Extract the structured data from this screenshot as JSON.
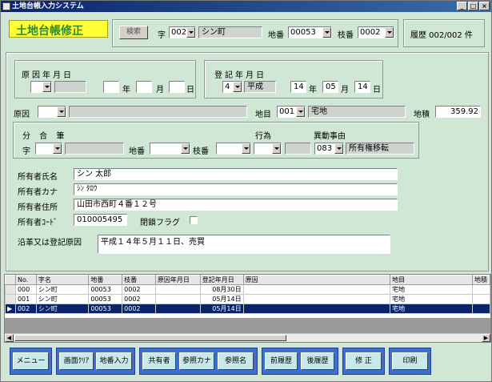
{
  "window": {
    "title": "土地台帳入力システム",
    "min": "_",
    "max": "□",
    "close": "×"
  },
  "header": {
    "form_title": "土地台帳修正",
    "search_button": "検索",
    "aza_label": "字",
    "aza_code": "002",
    "aza_name": "シン町",
    "chiban_label": "地番",
    "chiban_value": "00053",
    "edaban_label": "枝番",
    "edaban_value": "0002",
    "history": "履歴 002/002 件"
  },
  "cause_date": {
    "title": "原因年月日",
    "era": "",
    "era_name": "",
    "year_label": "年",
    "month_label": "月",
    "day_label": "日",
    "year": "",
    "month": "",
    "day": ""
  },
  "reg_date": {
    "title": "登記年月日",
    "era": "4",
    "era_name": "平成",
    "year": "14",
    "year_label": "年",
    "month": "05",
    "month_label": "月",
    "day": "14",
    "day_label": "日"
  },
  "row2": {
    "cause_label": "原因",
    "cause_code": "",
    "cause_name": "",
    "chimoku_label": "地目",
    "chimoku_code": "001",
    "chimoku_name": "宅地",
    "area_label": "地積",
    "area_value": "359.92"
  },
  "bunpitsu": {
    "title": "分 合 筆",
    "aza_label": "字",
    "aza_code": "",
    "aza_name": "",
    "chiban_label": "地番",
    "edaban_label": "枝番",
    "koui_label": "行為",
    "idou_label": "異動事由",
    "idou_code": "083",
    "idou_name": "所有権移転"
  },
  "owner": {
    "name_label": "所有者氏名",
    "name": "シン 太郎",
    "kana_label": "所有者カナ",
    "kana": "ｼﾝ ﾀﾛｳ",
    "address_label": "所有者住所",
    "address": "山田市西町４番１２号",
    "code_label": "所有者ｺｰﾄﾞ",
    "code": "010005495",
    "lock_label": "閉鎖フラグ",
    "history_label": "沿革又は登記原因",
    "history_text": "平成１４年５月１１日、売買"
  },
  "grid": {
    "columns": [
      "No.",
      "字名",
      "地番",
      "枝番",
      "原因年月日",
      "登記年月日",
      "原因",
      "地目",
      "地積"
    ],
    "rows": [
      [
        "000",
        "シン町",
        "00053",
        "0002",
        "",
        "08月30日",
        "",
        "宅地",
        ""
      ],
      [
        "001",
        "シン町",
        "00053",
        "0002",
        "",
        "05月14日",
        "",
        "宅地",
        ""
      ],
      [
        "002",
        "シン町",
        "00053",
        "0002",
        "",
        "05月14日",
        "",
        "宅地",
        ""
      ]
    ],
    "selected_index": 2
  },
  "buttons": {
    "menu": "メニュー",
    "screen_clear": "画面ｸﾘｱ",
    "chiban_input": "地番入力",
    "kyoyusha": "共有者",
    "sansho_kana": "参照カナ",
    "sansho_name": "参照名",
    "prev_history": "前履歴",
    "next_history": "後履歴",
    "modify": "修 正",
    "print": "印刷"
  }
}
